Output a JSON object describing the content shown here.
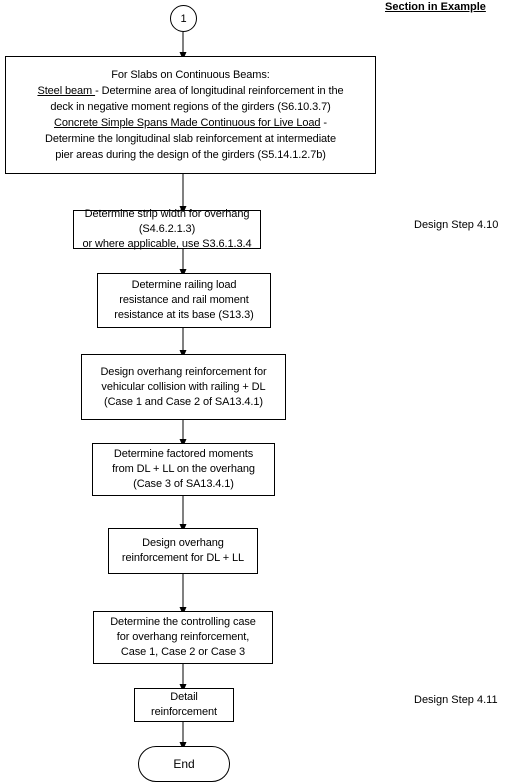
{
  "page": {
    "title": "Bridge Deck Design Flowchart - Overhang Reinforcement",
    "background_color": "#ffffff",
    "line_color": "#000000"
  },
  "header": {
    "section_column_label": "Section in Example"
  },
  "connector": {
    "label": "1",
    "name": "connector-1"
  },
  "nodes": [
    {
      "id": "slabs-continuous-beams",
      "type": "process",
      "lines": [
        {
          "segments": [
            {
              "text": "For Slabs on Continuous Beams:",
              "underline": false
            }
          ]
        },
        {
          "segments": [
            {
              "text": "Steel beam ",
              "underline": true
            },
            {
              "text": "- Determine area of longitudinal reinforcement in the",
              "underline": false
            }
          ]
        },
        {
          "segments": [
            {
              "text": "deck in negative moment regions of the girders (S6.10.3.7)",
              "underline": false
            }
          ]
        },
        {
          "segments": [
            {
              "text": "Concrete Simple Spans Made Continuous for Live Load",
              "underline": true
            },
            {
              "text": " -",
              "underline": false
            }
          ]
        },
        {
          "segments": [
            {
              "text": "Determine the longitudinal slab reinforcement at intermediate",
              "underline": false
            }
          ]
        },
        {
          "segments": [
            {
              "text": "pier areas during the design of the girders (S5.14.1.2.7b)",
              "underline": false
            }
          ]
        }
      ],
      "plain_text": "For Slabs on Continuous Beams:\nSteel beam - Determine area of longitudinal reinforcement in the deck in negative moment regions of the girders (S6.10.3.7)\nConcrete Simple Spans Made Continuous for Live Load - Determine the longitudinal slab reinforcement at intermediate pier areas during the design of the girders (S5.14.1.2.7b)"
    },
    {
      "id": "strip-width-overhang",
      "type": "process",
      "text": "Determine strip width for overhang (S4.6.2.1.3)\nor where applicable, use S3.6.1.3.4"
    },
    {
      "id": "railing-load-resistance",
      "type": "process",
      "text": "Determine railing load\nresistance and rail moment\nresistance at its base (S13.3)"
    },
    {
      "id": "overhang-reinf-collision",
      "type": "process",
      "text": "Design overhang reinforcement for\nvehicular collision with railing + DL\n(Case 1 and Case 2 of SA13.4.1)"
    },
    {
      "id": "factored-moments-dl-ll",
      "type": "process",
      "text": "Determine factored moments\nfrom DL + LL on the overhang\n(Case 3 of SA13.4.1)"
    },
    {
      "id": "overhang-reinf-dl-ll",
      "type": "process",
      "text": "Design overhang\nreinforcement for DL + LL"
    },
    {
      "id": "controlling-case",
      "type": "process",
      "text": "Determine the controlling case\nfor overhang reinforcement,\nCase 1, Case 2 or Case 3"
    },
    {
      "id": "detail-reinforcement",
      "type": "process",
      "text": "Detail\nreinforcement"
    }
  ],
  "terminator": {
    "label": "End",
    "name": "end-terminator"
  },
  "side_labels": [
    {
      "id": "design-step-4-10",
      "text": "Design Step 4.10"
    },
    {
      "id": "design-step-4-11",
      "text": "Design Step 4.11"
    }
  ]
}
